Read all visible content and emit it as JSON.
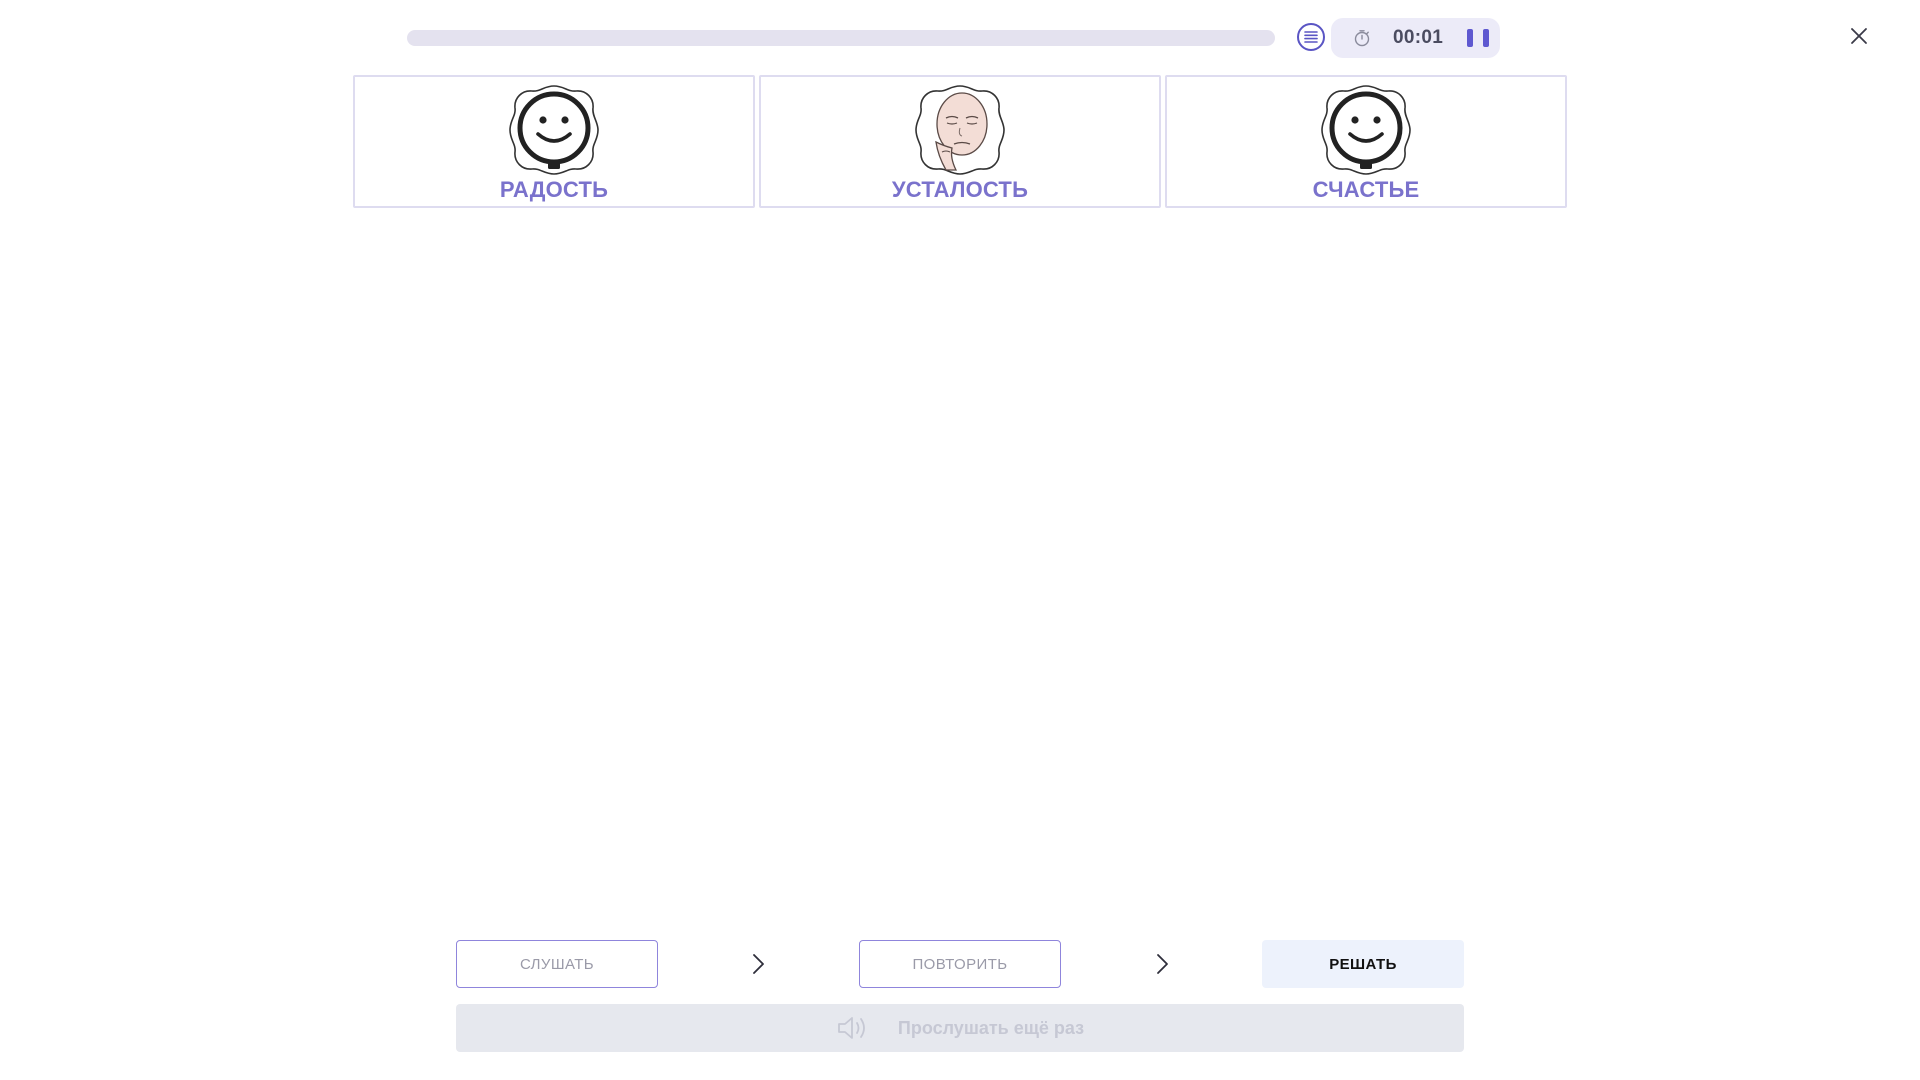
{
  "header": {
    "progress": 0,
    "timer": "00:01",
    "list_icon": "list-icon",
    "timer_icon": "stopwatch-icon",
    "pause_icon": "pause-icon",
    "close_icon": "close-icon"
  },
  "cards": [
    {
      "label": "РАДОСТЬ",
      "icon": "smiley-face-icon"
    },
    {
      "label": "УСТАЛОСТЬ",
      "icon": "tired-face-icon"
    },
    {
      "label": "СЧАСТЬЕ",
      "icon": "smiley-face-icon"
    }
  ],
  "steps": {
    "listen": "СЛУШАТЬ",
    "repeat": "ПОВТОРИТЬ",
    "solve": "РЕШАТЬ"
  },
  "listen_again": {
    "label": "Прослушать ещё раз",
    "icon": "speaker-icon"
  },
  "colors": {
    "accent": "#5e58d0",
    "card_label": "#7a72cc",
    "card_border": "#dedcf0",
    "progress_track": "#e4e2ef",
    "timer_bg": "#ecebf8",
    "active_step_bg": "#edf2fc",
    "disabled_bg": "#e6e8ee",
    "disabled_text": "#c6c8d4"
  }
}
